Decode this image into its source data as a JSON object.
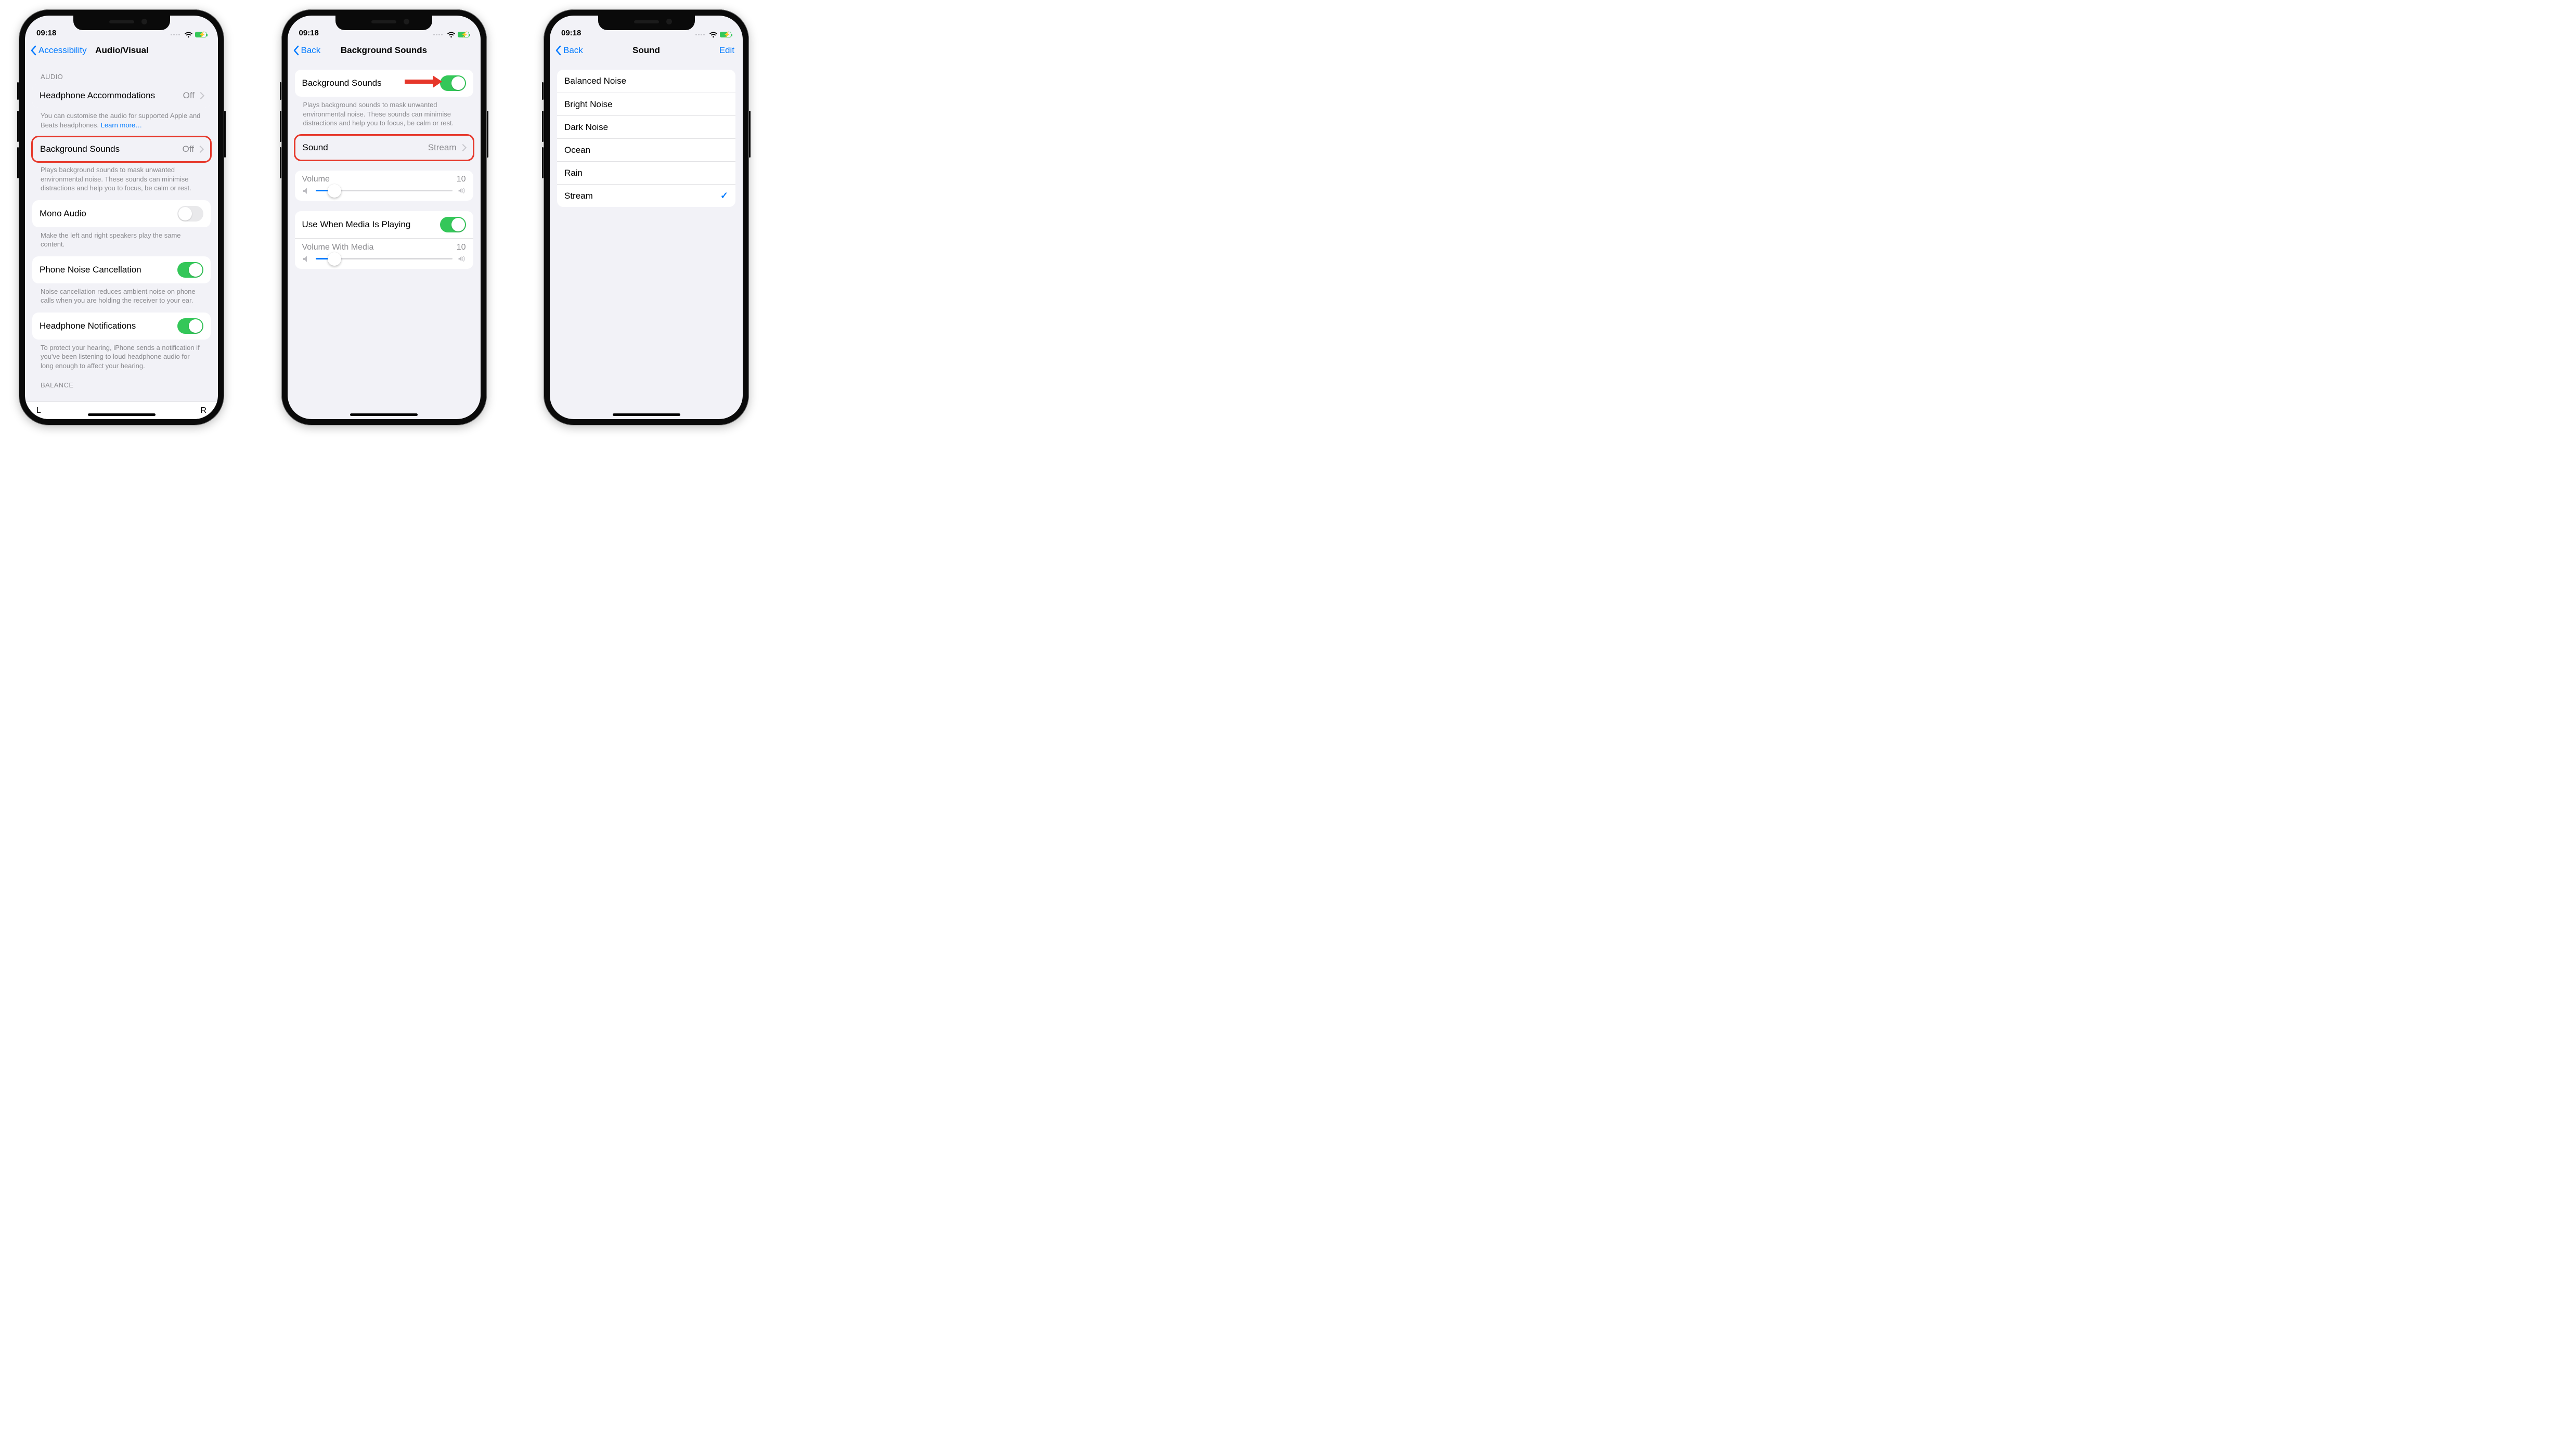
{
  "status": {
    "time": "09:18"
  },
  "phone1": {
    "nav_back": "Accessibility",
    "nav_title": "Audio/Visual",
    "section_audio": "AUDIO",
    "headphone_acc": {
      "label": "Headphone Accommodations",
      "value": "Off"
    },
    "headphone_note_pre": "You can customise the audio for supported Apple and Beats headphones. ",
    "headphone_note_link": "Learn more…",
    "bg_sounds": {
      "label": "Background Sounds",
      "value": "Off"
    },
    "bg_note": "Plays background sounds to mask unwanted environmental noise. These sounds can minimise distractions and help you to focus, be calm or rest.",
    "mono_audio": {
      "label": "Mono Audio",
      "on": false
    },
    "mono_note": "Make the left and right speakers play the same content.",
    "noise_cancel": {
      "label": "Phone Noise Cancellation",
      "on": true
    },
    "noise_note": "Noise cancellation reduces ambient noise on phone calls when you are holding the receiver to your ear.",
    "head_notif": {
      "label": "Headphone Notifications",
      "on": true
    },
    "head_notif_note": "To protect your hearing, iPhone sends a notification if you've been listening to loud headphone audio for long enough to affect your hearing.",
    "section_balance": "BALANCE",
    "balance_L": "L",
    "balance_R": "R"
  },
  "phone2": {
    "nav_back": "Back",
    "nav_title": "Background Sounds",
    "toggle": {
      "label": "Background Sounds",
      "on": true
    },
    "toggle_note": "Plays background sounds to mask unwanted environmental noise. These sounds can minimise distractions and help you to focus, be calm or rest.",
    "sound": {
      "label": "Sound",
      "value": "Stream"
    },
    "volume": {
      "label": "Volume",
      "value": "10",
      "pct": 14
    },
    "media_toggle": {
      "label": "Use When Media Is Playing",
      "on": true
    },
    "volume_media": {
      "label": "Volume With Media",
      "value": "10",
      "pct": 14
    }
  },
  "phone3": {
    "nav_back": "Back",
    "nav_title": "Sound",
    "nav_edit": "Edit",
    "options": [
      "Balanced Noise",
      "Bright Noise",
      "Dark Noise",
      "Ocean",
      "Rain",
      "Stream"
    ],
    "selected": "Stream"
  }
}
